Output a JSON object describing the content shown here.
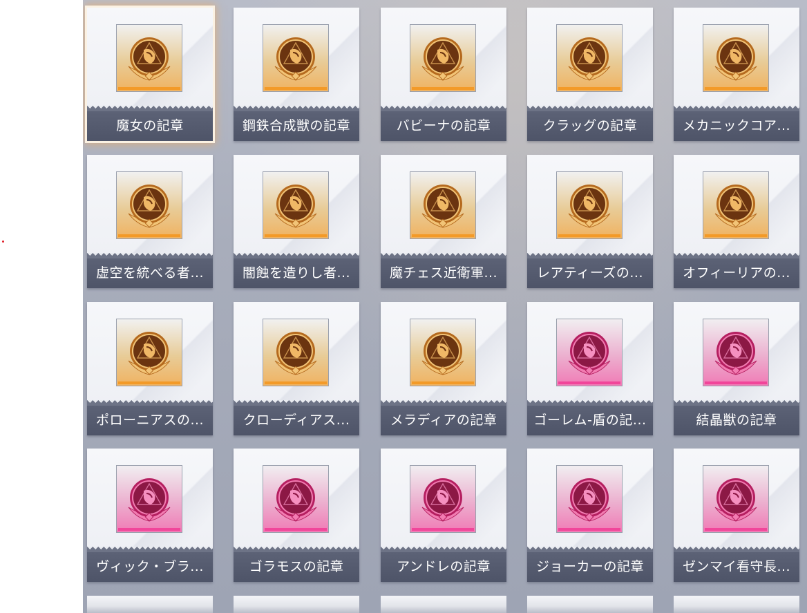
{
  "colors": {
    "gold_accent": "#f39a28",
    "pink_accent": "#f1459a",
    "label_bg": "#535a6e",
    "selected_glow": "#f5aa5a"
  },
  "emblems": [
    {
      "label": "魔女の記章",
      "tier": "gold",
      "icon": "witch-emblem-icon",
      "selected": true
    },
    {
      "label": "鋼鉄合成獣の記章",
      "tier": "gold",
      "icon": "steel-chimera-emblem-icon",
      "selected": false
    },
    {
      "label": "バビーナの記章",
      "tier": "gold",
      "icon": "babina-emblem-icon",
      "selected": false
    },
    {
      "label": "クラッグの記章",
      "tier": "gold",
      "icon": "crag-emblem-icon",
      "selected": false
    },
    {
      "label": "メカニックコア...",
      "tier": "gold",
      "icon": "mechanic-core-emblem-icon",
      "selected": false
    },
    {
      "label": "虚空を統べる者...",
      "tier": "gold",
      "icon": "void-ruler-emblem-icon",
      "selected": false
    },
    {
      "label": "闇蝕を造りし者...",
      "tier": "gold",
      "icon": "dark-erosion-creator-emblem-icon",
      "selected": false
    },
    {
      "label": "魔チェス近衛軍...",
      "tier": "gold",
      "icon": "magic-chess-guard-emblem-icon",
      "selected": false
    },
    {
      "label": "レアティーズの...",
      "tier": "gold",
      "icon": "laertes-emblem-icon",
      "selected": false
    },
    {
      "label": "オフィーリアの...",
      "tier": "gold",
      "icon": "ophelia-emblem-icon",
      "selected": false
    },
    {
      "label": "ポローニアスの...",
      "tier": "gold",
      "icon": "polonius-emblem-icon",
      "selected": false
    },
    {
      "label": "クローディアス...",
      "tier": "gold",
      "icon": "claudius-emblem-icon",
      "selected": false
    },
    {
      "label": "メラディアの記章",
      "tier": "gold",
      "icon": "meradia-emblem-icon",
      "selected": false
    },
    {
      "label": "ゴーレム-盾の記...",
      "tier": "pink",
      "icon": "golem-shield-emblem-icon",
      "selected": false
    },
    {
      "label": "結晶獣の記章",
      "tier": "pink",
      "icon": "crystal-beast-emblem-icon",
      "selected": false
    },
    {
      "label": "ヴィック・ブラ...",
      "tier": "pink",
      "icon": "vick-bra-emblem-icon",
      "selected": false
    },
    {
      "label": "ゴラモスの記章",
      "tier": "pink",
      "icon": "goramos-emblem-icon",
      "selected": false
    },
    {
      "label": "アンドレの記章",
      "tier": "pink",
      "icon": "andre-emblem-icon",
      "selected": false
    },
    {
      "label": "ジョーカーの記章",
      "tier": "pink",
      "icon": "joker-emblem-icon",
      "selected": false
    },
    {
      "label": "ゼンマイ看守長...",
      "tier": "pink",
      "icon": "zenmai-warden-emblem-icon",
      "selected": false
    }
  ]
}
